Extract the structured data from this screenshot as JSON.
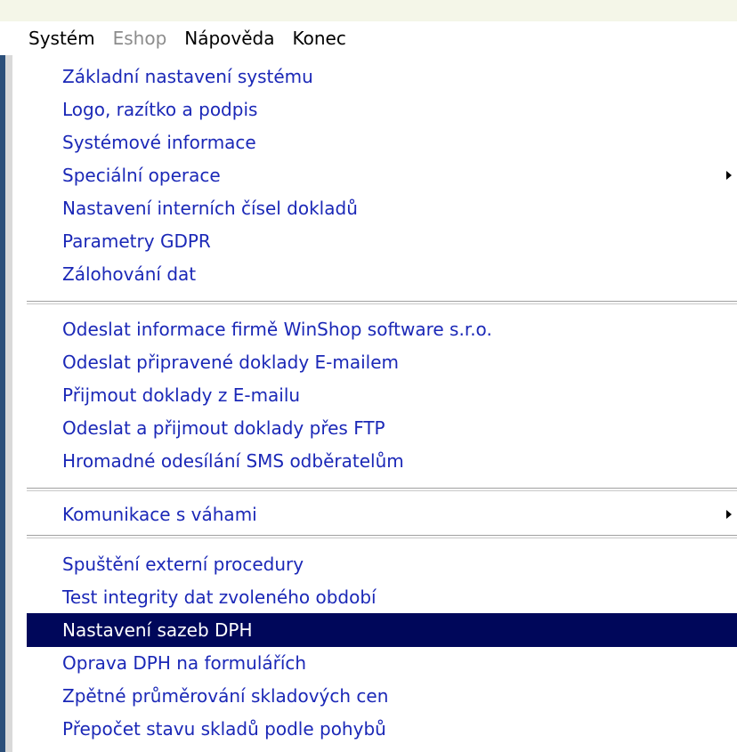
{
  "menubar": {
    "items": [
      {
        "label": "Systém",
        "enabled": true
      },
      {
        "label": "Eshop",
        "enabled": false
      },
      {
        "label": "Nápověda",
        "enabled": true
      },
      {
        "label": "Konec",
        "enabled": true
      }
    ]
  },
  "menu": {
    "group1": [
      {
        "label": "Základní nastavení systému"
      },
      {
        "label": "Logo, razítko a podpis"
      },
      {
        "label": "Systémové informace"
      },
      {
        "label": "Speciální operace",
        "submenu": true
      },
      {
        "label": "Nastavení interních čísel dokladů"
      },
      {
        "label": "Parametry GDPR"
      },
      {
        "label": "Zálohování dat"
      }
    ],
    "group2": [
      {
        "label": "Odeslat informace firmě WinShop software s.r.o."
      },
      {
        "label": "Odeslat připravené doklady E-mailem"
      },
      {
        "label": "Přijmout doklady z E-mailu"
      },
      {
        "label": "Odeslat a přijmout doklady přes FTP"
      },
      {
        "label": "Hromadné odesílání SMS odběratelům"
      }
    ],
    "group3": [
      {
        "label": "Komunikace s váhami",
        "submenu": true
      }
    ],
    "group4": [
      {
        "label": "Spuštění externí procedury"
      },
      {
        "label": "Test integrity dat zvoleného období"
      },
      {
        "label": "Nastavení sazeb DPH",
        "selected": true
      },
      {
        "label": "Oprava DPH na formulářích"
      },
      {
        "label": "Zpětné průměrování skladových cen"
      },
      {
        "label": "Přepočet stavu skladů podle pohybů"
      }
    ]
  },
  "colors": {
    "item_text": "#1b28b7",
    "selected_bg": "#00075a",
    "selected_text": "#ffffff",
    "disabled_text": "#8c8c8c"
  }
}
